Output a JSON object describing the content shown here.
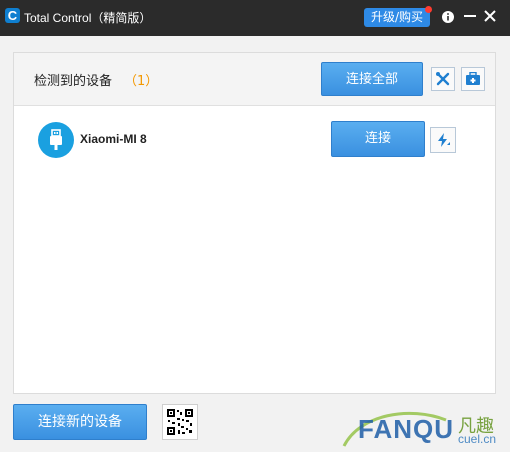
{
  "window": {
    "title": "Total Control（精简版）",
    "logo_letter": "C",
    "upgrade_label": "升级/购买"
  },
  "header": {
    "title": "检测到的设备",
    "count": "（1）",
    "connect_all_label": "连接全部"
  },
  "devices": [
    {
      "name": "Xiaomi-MI 8",
      "connect_label": "连接"
    }
  ],
  "footer": {
    "connect_new_label": "连接新的设备"
  },
  "watermark": {
    "brand": "FANQU",
    "cn": "凡趣",
    "url": "cuel.cn"
  },
  "colors": {
    "titlebar": "#2b2b2b",
    "accent": "#3a90e0",
    "count_orange": "#f39800"
  }
}
